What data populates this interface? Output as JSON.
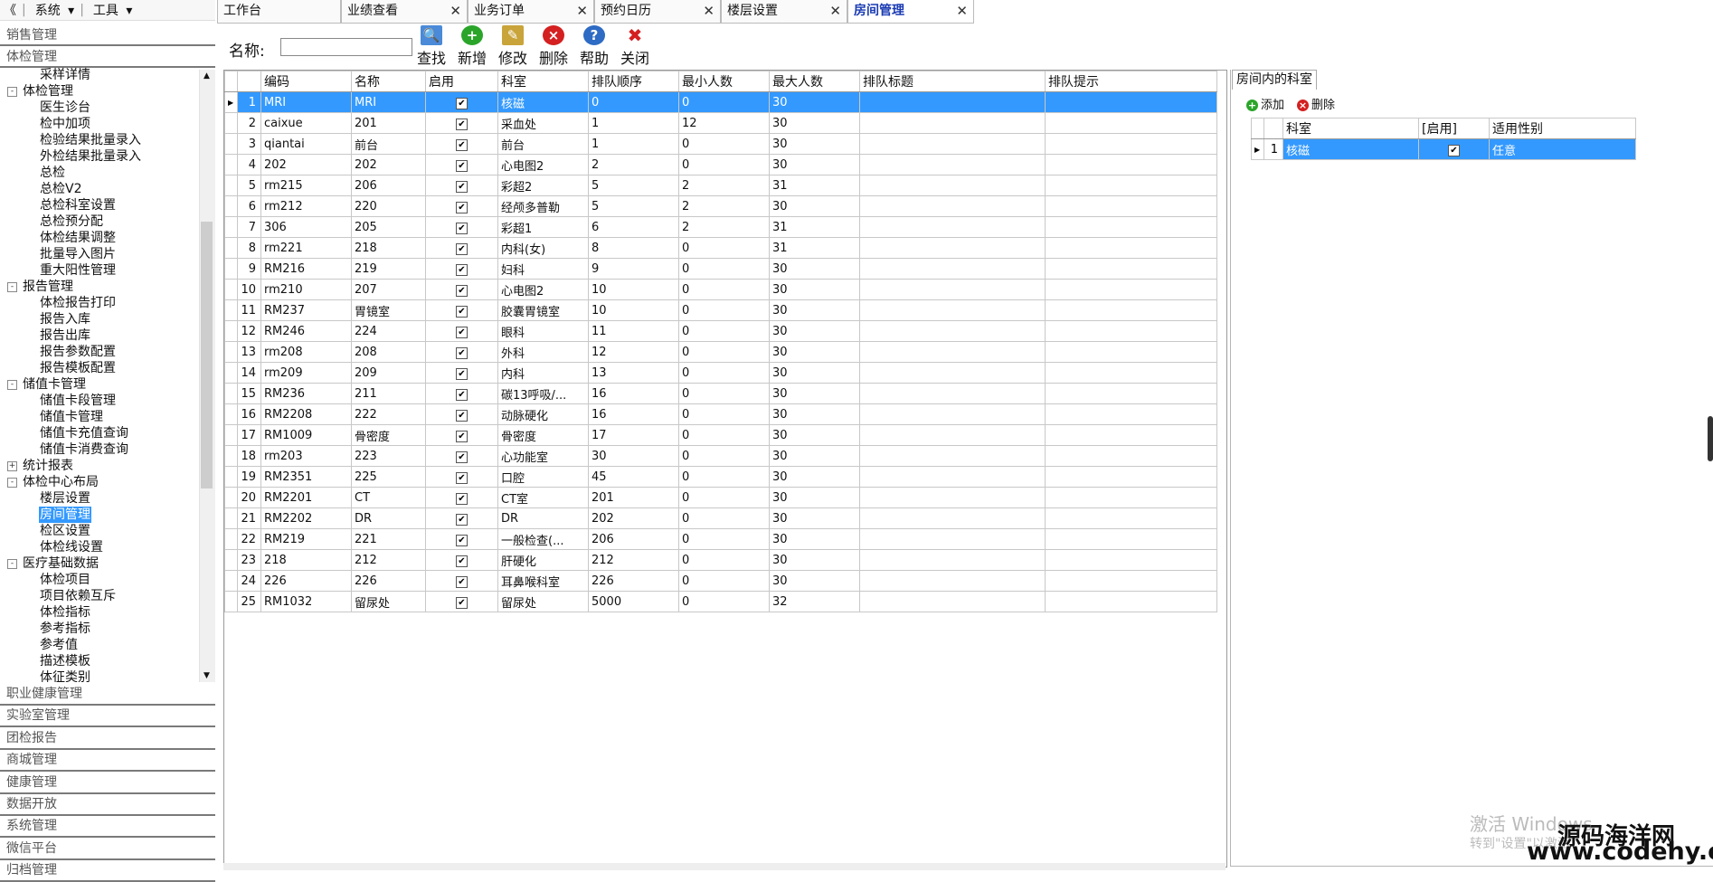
{
  "topmenu": {
    "collapse": "《",
    "system": "系统",
    "tools": "工具"
  },
  "categories_top": [
    "销售管理",
    "体检管理"
  ],
  "categories_bottom": [
    "职业健康管理",
    "实验室管理",
    "团检报告",
    "商城管理",
    "健康管理",
    "数据开放",
    "系统管理",
    "微信平台",
    "归档管理"
  ],
  "tree": [
    {
      "label": "采样详情",
      "level": 2
    },
    {
      "label": "体检管理",
      "level": 1,
      "exp": "-"
    },
    {
      "label": "医生诊台",
      "level": 2
    },
    {
      "label": "检中加项",
      "level": 2
    },
    {
      "label": "检验结果批量录入",
      "level": 2
    },
    {
      "label": "外检结果批量录入",
      "level": 2
    },
    {
      "label": "总检",
      "level": 2
    },
    {
      "label": "总检V2",
      "level": 2
    },
    {
      "label": "总检科室设置",
      "level": 2
    },
    {
      "label": "总检预分配",
      "level": 2
    },
    {
      "label": "体检结果调整",
      "level": 2
    },
    {
      "label": "批量导入图片",
      "level": 2
    },
    {
      "label": "重大阳性管理",
      "level": 2
    },
    {
      "label": "报告管理",
      "level": 1,
      "exp": "-"
    },
    {
      "label": "体检报告打印",
      "level": 2
    },
    {
      "label": "报告入库",
      "level": 2
    },
    {
      "label": "报告出库",
      "level": 2
    },
    {
      "label": "报告参数配置",
      "level": 2
    },
    {
      "label": "报告模板配置",
      "level": 2
    },
    {
      "label": "储值卡管理",
      "level": 1,
      "exp": "-"
    },
    {
      "label": "储值卡段管理",
      "level": 2
    },
    {
      "label": "储值卡管理",
      "level": 2
    },
    {
      "label": "储值卡充值查询",
      "level": 2
    },
    {
      "label": "储值卡消费查询",
      "level": 2
    },
    {
      "label": "统计报表",
      "level": 1,
      "exp": "+"
    },
    {
      "label": "体检中心布局",
      "level": 1,
      "exp": "-"
    },
    {
      "label": "楼层设置",
      "level": 2
    },
    {
      "label": "房间管理",
      "level": 2,
      "selected": true
    },
    {
      "label": "检区设置",
      "level": 2
    },
    {
      "label": "体检线设置",
      "level": 2
    },
    {
      "label": "医疗基础数据",
      "level": 1,
      "exp": "-"
    },
    {
      "label": "体检项目",
      "level": 2
    },
    {
      "label": "项目依赖互斥",
      "level": 2
    },
    {
      "label": "体检指标",
      "level": 2
    },
    {
      "label": "参考指标",
      "level": 2
    },
    {
      "label": "参考值",
      "level": 2
    },
    {
      "label": "描述模板",
      "level": 2
    },
    {
      "label": "体征类别",
      "level": 2
    }
  ],
  "tabs": [
    {
      "label": "工作台",
      "closable": false
    },
    {
      "label": "业绩查看",
      "closable": true
    },
    {
      "label": "业务订单",
      "closable": true
    },
    {
      "label": "预约日历",
      "closable": true
    },
    {
      "label": "楼层设置",
      "closable": true
    },
    {
      "label": "房间管理",
      "closable": true,
      "active": true
    }
  ],
  "toolbar": {
    "name_label": "名称:",
    "name_value": "",
    "buttons": [
      {
        "label": "查找",
        "icon": "search-icon",
        "color": "#4a8ad8"
      },
      {
        "label": "新增",
        "icon": "add-icon",
        "color": "#2aa52a"
      },
      {
        "label": "修改",
        "icon": "edit-icon",
        "color": "#c9a43a"
      },
      {
        "label": "删除",
        "icon": "delete-icon",
        "color": "#d42020"
      },
      {
        "label": "帮助",
        "icon": "help-icon",
        "color": "#2d6bc4"
      },
      {
        "label": "关闭",
        "icon": "close-icon",
        "color": "#d42020"
      }
    ]
  },
  "grid": {
    "columns": [
      "编码",
      "名称",
      "启用",
      "科室",
      "排队顺序",
      "最小人数",
      "最大人数",
      "排队标题",
      "排队提示"
    ],
    "rows": [
      [
        "1",
        "MRI",
        "MRI",
        true,
        "核磁",
        "0",
        "0",
        "30",
        "",
        ""
      ],
      [
        "2",
        "caixue",
        "201",
        true,
        "采血处",
        "1",
        "12",
        "30",
        "",
        ""
      ],
      [
        "3",
        "qiantai",
        "前台",
        true,
        "前台",
        "1",
        "0",
        "30",
        "",
        ""
      ],
      [
        "4",
        "202",
        "202",
        true,
        "心电图2",
        "2",
        "0",
        "30",
        "",
        ""
      ],
      [
        "5",
        "rm215",
        "206",
        true,
        "彩超2",
        "5",
        "2",
        "31",
        "",
        ""
      ],
      [
        "6",
        "rm212",
        "220",
        true,
        "经颅多普勒",
        "5",
        "2",
        "30",
        "",
        ""
      ],
      [
        "7",
        "306",
        "205",
        true,
        "彩超1",
        "6",
        "2",
        "31",
        "",
        ""
      ],
      [
        "8",
        "rm221",
        "218",
        true,
        "内科(女)",
        "8",
        "0",
        "31",
        "",
        ""
      ],
      [
        "9",
        "RM216",
        "219",
        true,
        "妇科",
        "9",
        "0",
        "30",
        "",
        ""
      ],
      [
        "10",
        "rm210",
        "207",
        true,
        "心电图2",
        "10",
        "0",
        "30",
        "",
        ""
      ],
      [
        "11",
        "RM237",
        "胃镜室",
        true,
        "胶囊胃镜室",
        "10",
        "0",
        "30",
        "",
        ""
      ],
      [
        "12",
        "RM246",
        "224",
        true,
        "眼科",
        "11",
        "0",
        "30",
        "",
        ""
      ],
      [
        "13",
        "rm208",
        "208",
        true,
        "外科",
        "12",
        "0",
        "30",
        "",
        ""
      ],
      [
        "14",
        "rm209",
        "209",
        true,
        "内科",
        "13",
        "0",
        "30",
        "",
        ""
      ],
      [
        "15",
        "RM236",
        "211",
        true,
        "碳13呼吸/...",
        "16",
        "0",
        "30",
        "",
        ""
      ],
      [
        "16",
        "RM2208",
        "222",
        true,
        "动脉硬化",
        "16",
        "0",
        "30",
        "",
        ""
      ],
      [
        "17",
        "RM1009",
        "骨密度",
        true,
        "骨密度",
        "17",
        "0",
        "30",
        "",
        ""
      ],
      [
        "18",
        "rm203",
        "223",
        true,
        "心功能室",
        "30",
        "0",
        "30",
        "",
        ""
      ],
      [
        "19",
        "RM2351",
        "225",
        true,
        "口腔",
        "45",
        "0",
        "30",
        "",
        ""
      ],
      [
        "20",
        "RM2201",
        "CT",
        true,
        "CT室",
        "201",
        "0",
        "30",
        "",
        ""
      ],
      [
        "21",
        "RM2202",
        "DR",
        true,
        "DR",
        "202",
        "0",
        "30",
        "",
        ""
      ],
      [
        "22",
        "RM219",
        "221",
        true,
        "一般检查(...",
        "206",
        "0",
        "30",
        "",
        ""
      ],
      [
        "23",
        "218",
        "212",
        true,
        "肝硬化",
        "212",
        "0",
        "30",
        "",
        ""
      ],
      [
        "24",
        "226",
        "226",
        true,
        "耳鼻喉科室",
        "226",
        "0",
        "30",
        "",
        ""
      ],
      [
        "25",
        "RM1032",
        "留尿处",
        true,
        "留尿处",
        "5000",
        "0",
        "32",
        "",
        ""
      ]
    ],
    "selected_row": 0
  },
  "right_panel": {
    "tab": "房间内的科室",
    "add_label": "添加",
    "delete_label": "删除",
    "columns": [
      "科室",
      "[启用]",
      "适用性别"
    ],
    "rows": [
      [
        "1",
        "核磁",
        true,
        "任意"
      ]
    ]
  },
  "watermark": {
    "line1": "激活 Windows",
    "line2": "转到\"设置\"以激活"
  },
  "brand": {
    "name": "源码海洋网",
    "url": "www.codehy.com"
  },
  "colors": {
    "selection": "#3399ff",
    "active_tab_text": "#1a3bb3"
  }
}
